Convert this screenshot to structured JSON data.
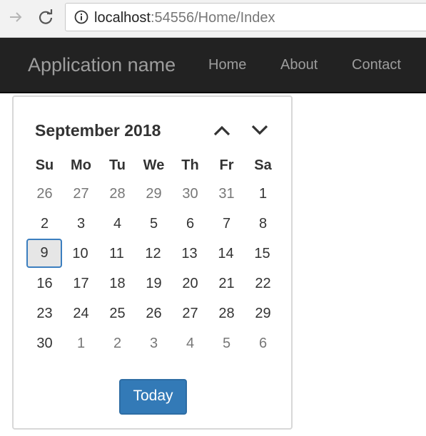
{
  "browser": {
    "url_host": "localhost",
    "url_rest": ":54556/Home/Index"
  },
  "navbar": {
    "brand": "Application name",
    "links": [
      {
        "label": "Home"
      },
      {
        "label": "About"
      },
      {
        "label": "Contact"
      }
    ]
  },
  "datepicker": {
    "title": "September 2018",
    "weekdays": [
      "Su",
      "Mo",
      "Tu",
      "We",
      "Th",
      "Fr",
      "Sa"
    ],
    "weeks": [
      [
        {
          "day": "26",
          "muted": true
        },
        {
          "day": "27",
          "muted": true
        },
        {
          "day": "28",
          "muted": true
        },
        {
          "day": "29",
          "muted": true
        },
        {
          "day": "30",
          "muted": true
        },
        {
          "day": "31",
          "muted": true
        },
        {
          "day": "1",
          "muted": false
        }
      ],
      [
        {
          "day": "2",
          "muted": false
        },
        {
          "day": "3",
          "muted": false
        },
        {
          "day": "4",
          "muted": false
        },
        {
          "day": "5",
          "muted": false
        },
        {
          "day": "6",
          "muted": false
        },
        {
          "day": "7",
          "muted": false
        },
        {
          "day": "8",
          "muted": false
        }
      ],
      [
        {
          "day": "9",
          "muted": false,
          "selected": true
        },
        {
          "day": "10",
          "muted": false
        },
        {
          "day": "11",
          "muted": false
        },
        {
          "day": "12",
          "muted": false
        },
        {
          "day": "13",
          "muted": false
        },
        {
          "day": "14",
          "muted": false
        },
        {
          "day": "15",
          "muted": false
        }
      ],
      [
        {
          "day": "16",
          "muted": false
        },
        {
          "day": "17",
          "muted": false
        },
        {
          "day": "18",
          "muted": false
        },
        {
          "day": "19",
          "muted": false
        },
        {
          "day": "20",
          "muted": false
        },
        {
          "day": "21",
          "muted": false
        },
        {
          "day": "22",
          "muted": false
        }
      ],
      [
        {
          "day": "23",
          "muted": false
        },
        {
          "day": "24",
          "muted": false
        },
        {
          "day": "25",
          "muted": false
        },
        {
          "day": "26",
          "muted": false
        },
        {
          "day": "27",
          "muted": false
        },
        {
          "day": "28",
          "muted": false
        },
        {
          "day": "29",
          "muted": false
        }
      ],
      [
        {
          "day": "30",
          "muted": false
        },
        {
          "day": "1",
          "muted": true
        },
        {
          "day": "2",
          "muted": true
        },
        {
          "day": "3",
          "muted": true
        },
        {
          "day": "4",
          "muted": true
        },
        {
          "day": "5",
          "muted": true
        },
        {
          "day": "6",
          "muted": true
        }
      ]
    ],
    "today_label": "Today",
    "colors": {
      "accent": "#337ab7",
      "selected_border": "#3b7ebf",
      "selected_bg": "#e6e6e6",
      "muted_text": "#777777"
    },
    "icons": {
      "prev": "chevron-up-icon",
      "next": "chevron-down-icon"
    }
  }
}
